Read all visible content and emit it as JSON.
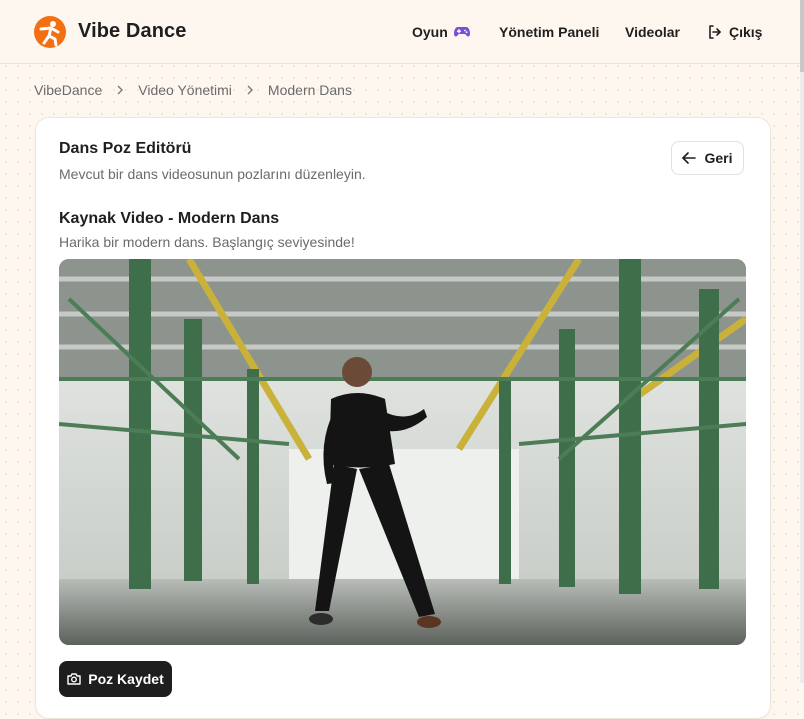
{
  "header": {
    "brand": "Vibe Dance",
    "nav": {
      "game": "Oyun",
      "admin": "Yönetim Paneli",
      "videos": "Videolar",
      "logout": "Çıkış"
    }
  },
  "breadcrumb": [
    "VibeDance",
    "Video Yönetimi",
    "Modern Dans"
  ],
  "editor": {
    "title": "Dans Poz Editörü",
    "description": "Mevcut bir dans videosunun pozlarını düzenleyin.",
    "back_label": "Geri"
  },
  "source_video": {
    "title": "Kaynak Video - Modern Dans",
    "description": "Harika bir modern dans. Başlangıç seviyesinde!"
  },
  "actions": {
    "save_pose": "Poz Kaydet"
  },
  "colors": {
    "brand_orange": "#f36f12",
    "background": "#fdf7f0",
    "button_dark": "#1e1e1e"
  },
  "icons": [
    "dancer-logo-icon",
    "gamepad-icon",
    "logout-icon",
    "chevron-right-icon",
    "arrow-left-icon",
    "camera-icon"
  ]
}
